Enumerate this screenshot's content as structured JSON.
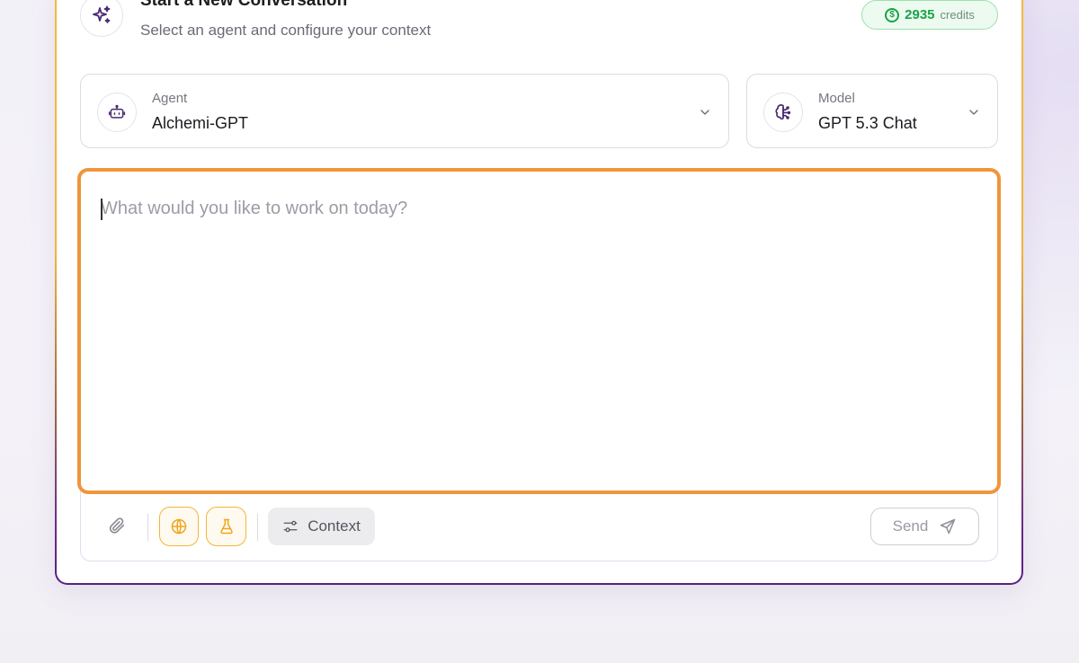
{
  "header": {
    "title": "Start a New Conversation",
    "subtitle": "Select an agent and configure your context",
    "credits_value": "2935",
    "credits_label": "credits",
    "credits_symbol": "$"
  },
  "agent_select": {
    "caption": "Agent",
    "value": "Alchemi-GPT",
    "icon": "robot-icon"
  },
  "model_select": {
    "caption": "Model",
    "value": "GPT 5.3 Chat",
    "icon": "brain-icon"
  },
  "prompt": {
    "placeholder": "What would you like to work on today?",
    "value": ""
  },
  "toolbar": {
    "attach_icon": "paperclip-icon",
    "web_search_icon": "globe-icon",
    "research_icon": "flask-icon",
    "context_label": "Context",
    "send_label": "Send"
  },
  "colors": {
    "accent_orange": "#f0953a",
    "accent_amber": "#f2b63a",
    "brand_purple": "#5a1e86",
    "credits_green": "#19a34a"
  }
}
